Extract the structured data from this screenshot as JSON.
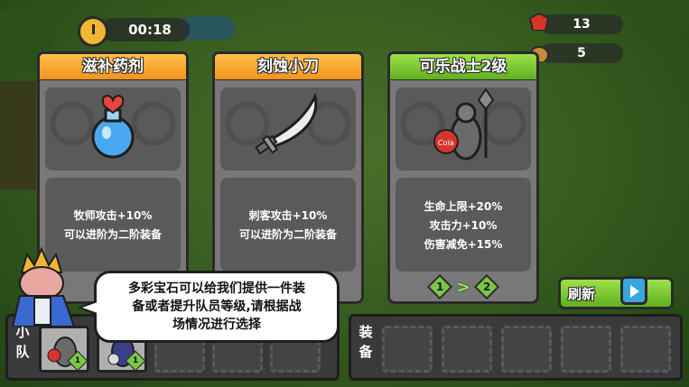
{
  "hud": {
    "timer": "00:18",
    "gems": "13",
    "potions": "5"
  },
  "cards": [
    {
      "title": "滋补药剂",
      "icon": "potion-icon",
      "desc": [
        "牧师攻击+10%",
        "可以进阶为二阶装备"
      ]
    },
    {
      "title": "刻蚀小刀",
      "icon": "knife-icon",
      "desc": [
        "刺客攻击+10%",
        "可以进阶为二阶装备"
      ]
    },
    {
      "title": "可乐战士2级",
      "icon": "cola-warrior-icon",
      "desc": [
        "生命上限+20%",
        "攻击力+10%",
        "伤害减免+15%"
      ],
      "level_from": "1",
      "level_to": "2"
    }
  ],
  "refresh_label": "刷新",
  "dialog": {
    "lines": [
      "多彩宝石可以给我们提供一件装",
      "备或者提升队员等级,请根据战",
      "场情况进行选择"
    ]
  },
  "team": {
    "label": "小队",
    "members": [
      {
        "level": "1",
        "icon": "cola-warrior-icon"
      },
      {
        "level": "1",
        "icon": "knight-icon"
      }
    ]
  },
  "equipment": {
    "label": "装备"
  },
  "colors": {
    "card_orange": "#f2931e",
    "card_green": "#5fb11f",
    "panel_gray": "#787878"
  }
}
